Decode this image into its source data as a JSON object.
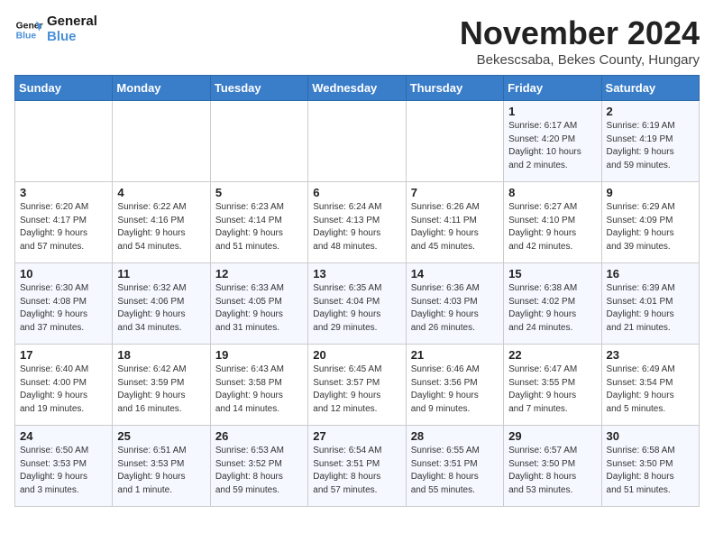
{
  "logo": {
    "line1": "General",
    "line2": "Blue"
  },
  "title": "November 2024",
  "subtitle": "Bekescsaba, Bekes County, Hungary",
  "days_of_week": [
    "Sunday",
    "Monday",
    "Tuesday",
    "Wednesday",
    "Thursday",
    "Friday",
    "Saturday"
  ],
  "weeks": [
    [
      {
        "day": "",
        "info": ""
      },
      {
        "day": "",
        "info": ""
      },
      {
        "day": "",
        "info": ""
      },
      {
        "day": "",
        "info": ""
      },
      {
        "day": "",
        "info": ""
      },
      {
        "day": "1",
        "info": "Sunrise: 6:17 AM\nSunset: 4:20 PM\nDaylight: 10 hours\nand 2 minutes."
      },
      {
        "day": "2",
        "info": "Sunrise: 6:19 AM\nSunset: 4:19 PM\nDaylight: 9 hours\nand 59 minutes."
      }
    ],
    [
      {
        "day": "3",
        "info": "Sunrise: 6:20 AM\nSunset: 4:17 PM\nDaylight: 9 hours\nand 57 minutes."
      },
      {
        "day": "4",
        "info": "Sunrise: 6:22 AM\nSunset: 4:16 PM\nDaylight: 9 hours\nand 54 minutes."
      },
      {
        "day": "5",
        "info": "Sunrise: 6:23 AM\nSunset: 4:14 PM\nDaylight: 9 hours\nand 51 minutes."
      },
      {
        "day": "6",
        "info": "Sunrise: 6:24 AM\nSunset: 4:13 PM\nDaylight: 9 hours\nand 48 minutes."
      },
      {
        "day": "7",
        "info": "Sunrise: 6:26 AM\nSunset: 4:11 PM\nDaylight: 9 hours\nand 45 minutes."
      },
      {
        "day": "8",
        "info": "Sunrise: 6:27 AM\nSunset: 4:10 PM\nDaylight: 9 hours\nand 42 minutes."
      },
      {
        "day": "9",
        "info": "Sunrise: 6:29 AM\nSunset: 4:09 PM\nDaylight: 9 hours\nand 39 minutes."
      }
    ],
    [
      {
        "day": "10",
        "info": "Sunrise: 6:30 AM\nSunset: 4:08 PM\nDaylight: 9 hours\nand 37 minutes."
      },
      {
        "day": "11",
        "info": "Sunrise: 6:32 AM\nSunset: 4:06 PM\nDaylight: 9 hours\nand 34 minutes."
      },
      {
        "day": "12",
        "info": "Sunrise: 6:33 AM\nSunset: 4:05 PM\nDaylight: 9 hours\nand 31 minutes."
      },
      {
        "day": "13",
        "info": "Sunrise: 6:35 AM\nSunset: 4:04 PM\nDaylight: 9 hours\nand 29 minutes."
      },
      {
        "day": "14",
        "info": "Sunrise: 6:36 AM\nSunset: 4:03 PM\nDaylight: 9 hours\nand 26 minutes."
      },
      {
        "day": "15",
        "info": "Sunrise: 6:38 AM\nSunset: 4:02 PM\nDaylight: 9 hours\nand 24 minutes."
      },
      {
        "day": "16",
        "info": "Sunrise: 6:39 AM\nSunset: 4:01 PM\nDaylight: 9 hours\nand 21 minutes."
      }
    ],
    [
      {
        "day": "17",
        "info": "Sunrise: 6:40 AM\nSunset: 4:00 PM\nDaylight: 9 hours\nand 19 minutes."
      },
      {
        "day": "18",
        "info": "Sunrise: 6:42 AM\nSunset: 3:59 PM\nDaylight: 9 hours\nand 16 minutes."
      },
      {
        "day": "19",
        "info": "Sunrise: 6:43 AM\nSunset: 3:58 PM\nDaylight: 9 hours\nand 14 minutes."
      },
      {
        "day": "20",
        "info": "Sunrise: 6:45 AM\nSunset: 3:57 PM\nDaylight: 9 hours\nand 12 minutes."
      },
      {
        "day": "21",
        "info": "Sunrise: 6:46 AM\nSunset: 3:56 PM\nDaylight: 9 hours\nand 9 minutes."
      },
      {
        "day": "22",
        "info": "Sunrise: 6:47 AM\nSunset: 3:55 PM\nDaylight: 9 hours\nand 7 minutes."
      },
      {
        "day": "23",
        "info": "Sunrise: 6:49 AM\nSunset: 3:54 PM\nDaylight: 9 hours\nand 5 minutes."
      }
    ],
    [
      {
        "day": "24",
        "info": "Sunrise: 6:50 AM\nSunset: 3:53 PM\nDaylight: 9 hours\nand 3 minutes."
      },
      {
        "day": "25",
        "info": "Sunrise: 6:51 AM\nSunset: 3:53 PM\nDaylight: 9 hours\nand 1 minute."
      },
      {
        "day": "26",
        "info": "Sunrise: 6:53 AM\nSunset: 3:52 PM\nDaylight: 8 hours\nand 59 minutes."
      },
      {
        "day": "27",
        "info": "Sunrise: 6:54 AM\nSunset: 3:51 PM\nDaylight: 8 hours\nand 57 minutes."
      },
      {
        "day": "28",
        "info": "Sunrise: 6:55 AM\nSunset: 3:51 PM\nDaylight: 8 hours\nand 55 minutes."
      },
      {
        "day": "29",
        "info": "Sunrise: 6:57 AM\nSunset: 3:50 PM\nDaylight: 8 hours\nand 53 minutes."
      },
      {
        "day": "30",
        "info": "Sunrise: 6:58 AM\nSunset: 3:50 PM\nDaylight: 8 hours\nand 51 minutes."
      }
    ]
  ]
}
